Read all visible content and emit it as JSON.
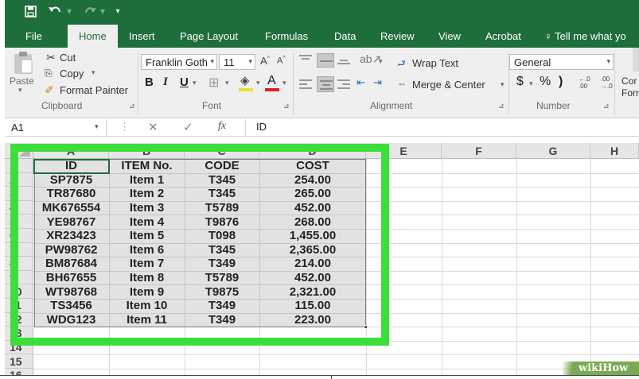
{
  "quick_access": {
    "save_icon": "save-icon",
    "undo_icon": "undo-icon",
    "redo_icon": "redo-icon",
    "customize_icon": "customize-icon"
  },
  "tabs": [
    "File",
    "Home",
    "Insert",
    "Page Layout",
    "Formulas",
    "Data",
    "Review",
    "View",
    "Acrobat",
    "Tell me what yo"
  ],
  "ribbon": {
    "clipboard": {
      "paste": "Paste",
      "cut": "Cut",
      "copy": "Copy",
      "format_painter": "Format Painter",
      "group_label": "Clipboard"
    },
    "font": {
      "family": "Franklin Goth",
      "size": "11",
      "bold": "B",
      "italic": "I",
      "underline": "U",
      "grow": "A",
      "shrink": "A",
      "font_color": "A",
      "group_label": "Font"
    },
    "alignment": {
      "wrap_text": "Wrap Text",
      "merge_center": "Merge & Center",
      "group_label": "Alignment"
    },
    "number": {
      "format": "General",
      "currency": "$",
      "percent": "%",
      "comma": ")",
      "inc_decimal": ".00",
      "group_label": "Number"
    },
    "styles_partial": [
      "Cor",
      "Forn"
    ]
  },
  "formula_bar": {
    "name_box": "A1",
    "fx": "fx",
    "content": "ID"
  },
  "sheet": {
    "columns": [
      "A",
      "B",
      "C",
      "D",
      "E",
      "F",
      "G",
      "H"
    ],
    "row_numbers": [
      "1",
      "2",
      "3",
      "4",
      "5",
      "6",
      "7",
      "8",
      "9",
      "10",
      "11",
      "12",
      "13",
      "14",
      "15",
      "16"
    ],
    "headers": [
      "ID",
      "ITEM No.",
      "CODE",
      "COST"
    ],
    "rows": [
      [
        "SP7875",
        "Item 1",
        "T345",
        "254.00"
      ],
      [
        "TR87680",
        "Item 2",
        "T345",
        "265.00"
      ],
      [
        "MK676554",
        "Item 3",
        "T5789",
        "452.00"
      ],
      [
        "YE98767",
        "Item 4",
        "T9876",
        "268.00"
      ],
      [
        "XR23423",
        "Item 5",
        "T098",
        "1,455.00"
      ],
      [
        "PW98762",
        "Item 6",
        "T345",
        "2,365.00"
      ],
      [
        "BM87684",
        "Item 7",
        "T349",
        "214.00"
      ],
      [
        "BH67655",
        "Item 8",
        "T5789",
        "452.00"
      ],
      [
        "WT98768",
        "Item 9",
        "T9875",
        "2,321.00"
      ],
      [
        "TS3456",
        "Item 10",
        "T349",
        "115.00"
      ],
      [
        "WDG123",
        "Item 11",
        "T349",
        "223.00"
      ]
    ]
  },
  "watermark": "wikiHow"
}
